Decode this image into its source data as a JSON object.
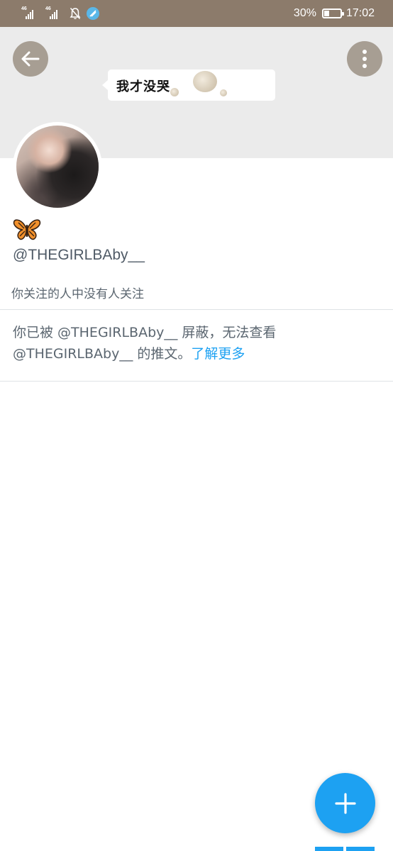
{
  "status_bar": {
    "network_1": "46",
    "network_2": "46",
    "battery_percent": "30%",
    "battery_level": 0.3,
    "time": "17:02",
    "bar_color": "#8c7b6b"
  },
  "header": {
    "back_icon": "arrow-left-icon",
    "more_icon": "more-vertical-icon",
    "banner_text": "我才没哭"
  },
  "profile": {
    "emoji": "butterfly-icon",
    "handle": "@THEGIRLBAby__",
    "follow_context": "你关注的人中没有人关注"
  },
  "blocked_notice": {
    "line1": "你已被 @THEGIRLBAby__ 屏蔽，无法查看",
    "line2": "@THEGIRLBAby__ 的推文。",
    "learn_more": "了解更多"
  },
  "fab": {
    "icon": "plus-icon",
    "color": "#1da1f2"
  }
}
